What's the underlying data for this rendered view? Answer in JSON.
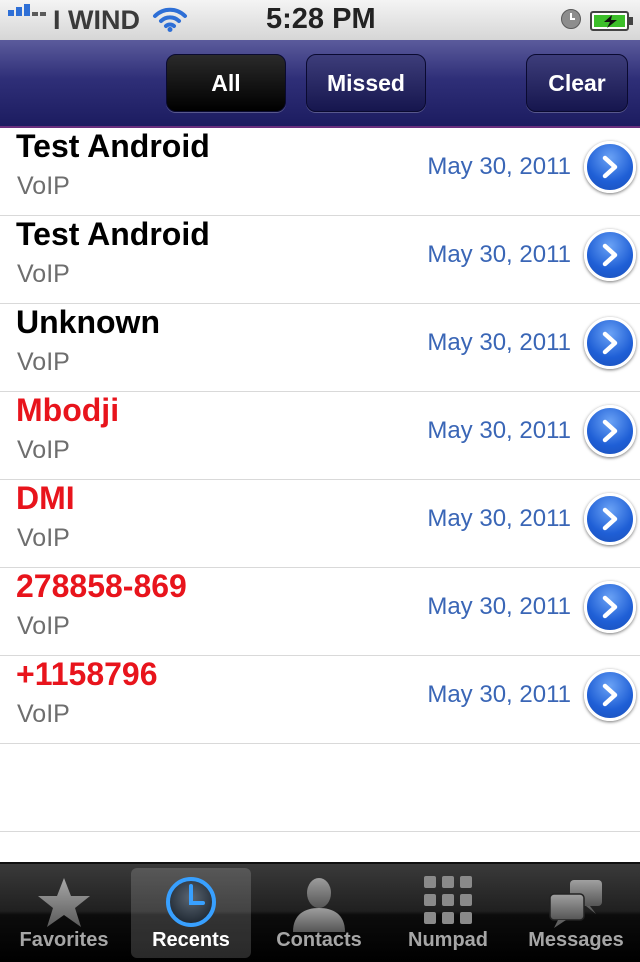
{
  "status": {
    "carrier": "I WIND",
    "time": "5:28 PM"
  },
  "nav": {
    "all_label": "All",
    "missed_label": "Missed",
    "clear_label": "Clear",
    "active": "All"
  },
  "calls": [
    {
      "name": "Test Android",
      "type": "VoIP",
      "date": "May 30, 2011",
      "missed": false
    },
    {
      "name": "Test Android",
      "type": "VoIP",
      "date": "May 30, 2011",
      "missed": false
    },
    {
      "name": "Unknown",
      "type": "VoIP",
      "date": "May 30, 2011",
      "missed": false
    },
    {
      "name": "Mbodji",
      "type": "VoIP",
      "date": "May 30, 2011",
      "missed": true
    },
    {
      "name": "DMI",
      "type": "VoIP",
      "date": "May 30, 2011",
      "missed": true
    },
    {
      "name": "278858-869",
      "type": "VoIP",
      "date": "May 30, 2011",
      "missed": true
    },
    {
      "name": "+1158796",
      "type": "VoIP",
      "date": "May 30, 2011",
      "missed": true
    }
  ],
  "tabs": [
    {
      "label": "Favorites",
      "icon": "star-icon"
    },
    {
      "label": "Recents",
      "icon": "clock-icon",
      "active": true
    },
    {
      "label": "Contacts",
      "icon": "person-icon"
    },
    {
      "label": "Numpad",
      "icon": "keypad-icon"
    },
    {
      "label": "Messages",
      "icon": "chat-bubbles-icon"
    }
  ],
  "colors": {
    "missed": "#e8141c",
    "date": "#3a66b6",
    "nav_bar": "#2f2f78"
  }
}
